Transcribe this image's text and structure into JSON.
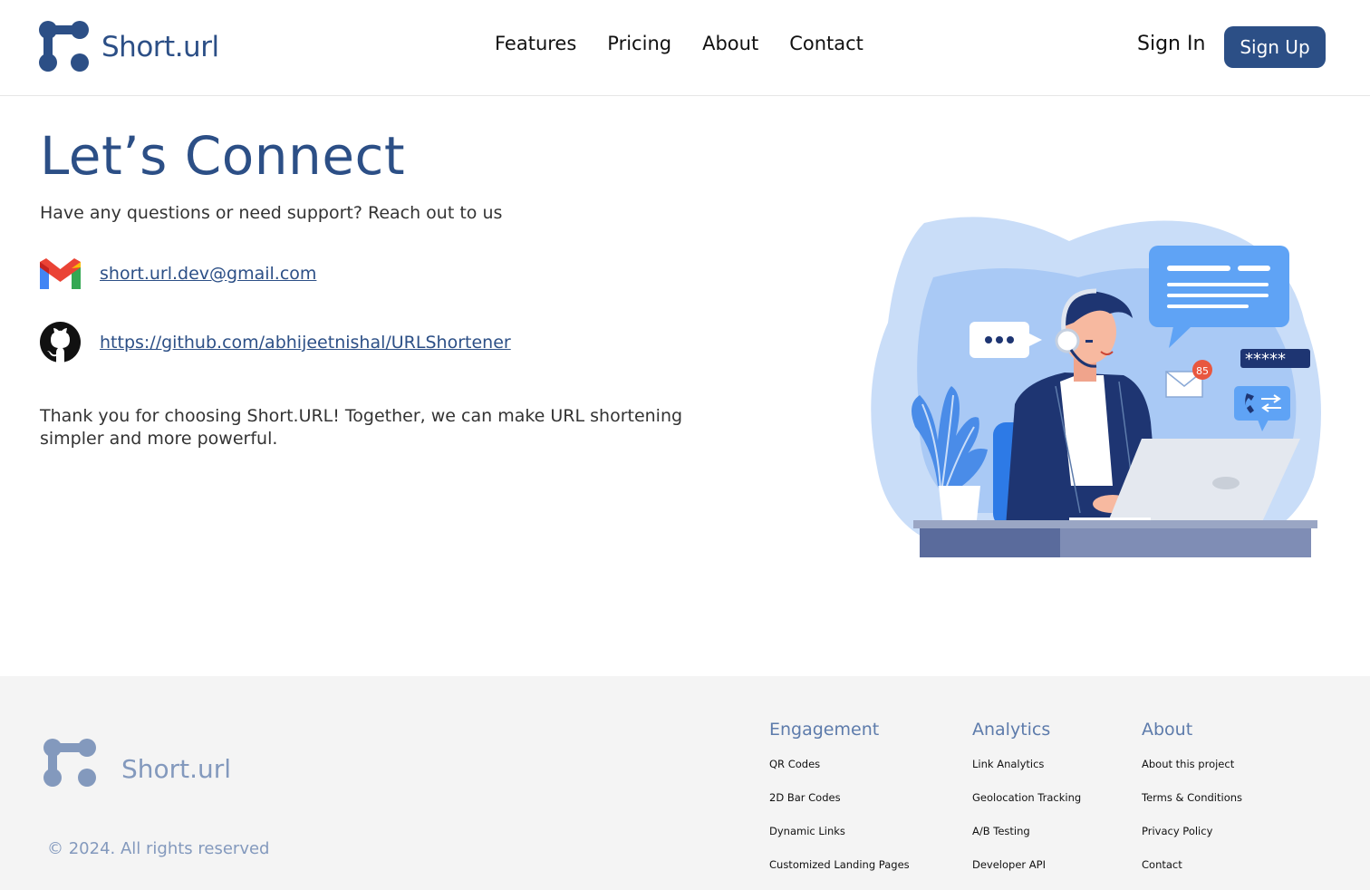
{
  "brand": {
    "name": "Short.url"
  },
  "nav": {
    "items": [
      {
        "label": "Features"
      },
      {
        "label": "Pricing"
      },
      {
        "label": "About"
      },
      {
        "label": "Contact"
      }
    ]
  },
  "auth": {
    "sign_in": "Sign In",
    "sign_up": "Sign Up"
  },
  "main": {
    "title": "Let’s Connect",
    "subtitle": "Have any questions or need support? Reach out to us",
    "email": "short.url.dev@gmail.com",
    "github": "https://github.com/abhijeetnishal/URLShortener",
    "thanks": "Thank you for choosing Short.URL! Together, we can make URL shortening simpler and more powerful.",
    "illustration": {
      "notification_count": "85",
      "password_mask": "*****"
    }
  },
  "footer": {
    "brand": "Short.url",
    "copyright": "© 2024. All rights reserved",
    "columns": [
      {
        "title": "Engagement",
        "links": [
          "QR Codes",
          "2D Bar Codes",
          "Dynamic Links",
          "Customized Landing Pages"
        ]
      },
      {
        "title": "Analytics",
        "links": [
          "Link Analytics",
          "Geolocation Tracking",
          "A/B Testing",
          "Developer API"
        ]
      },
      {
        "title": "About",
        "links": [
          "About this project",
          "Terms & Conditions",
          "Privacy Policy",
          "Contact"
        ]
      }
    ]
  },
  "colors": {
    "brand": "#2c4f86",
    "footer_bg": "#f4f4f4",
    "footer_text": "#8399bd",
    "footer_heading": "#5d7bab"
  }
}
